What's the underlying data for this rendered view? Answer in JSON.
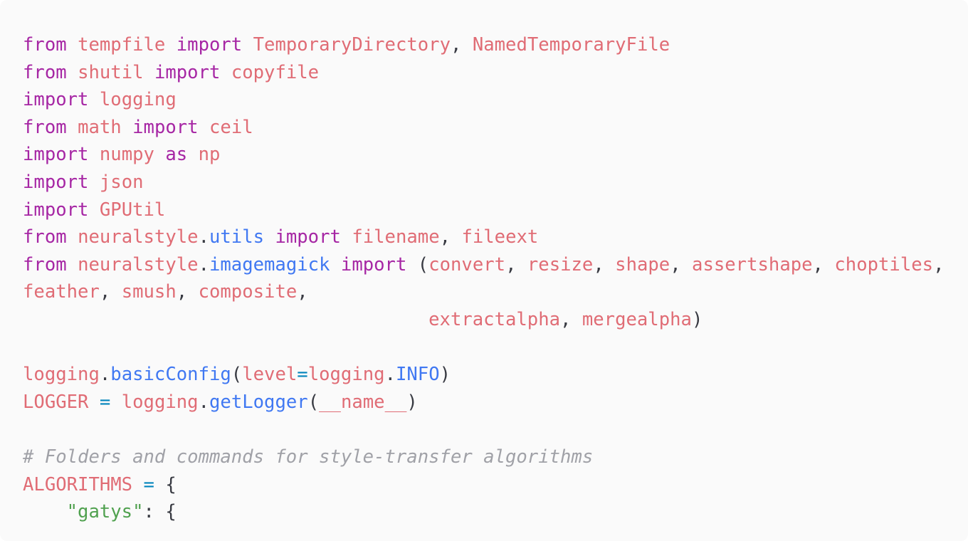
{
  "code": {
    "lines": [
      [
        [
          "kw",
          "from"
        ],
        [
          "pu",
          " "
        ],
        [
          "mod",
          "tempfile"
        ],
        [
          "pu",
          " "
        ],
        [
          "kw",
          "import"
        ],
        [
          "pu",
          " "
        ],
        [
          "id",
          "TemporaryDirectory"
        ],
        [
          "pu",
          ", "
        ],
        [
          "id",
          "NamedTemporaryFile"
        ]
      ],
      [
        [
          "kw",
          "from"
        ],
        [
          "pu",
          " "
        ],
        [
          "mod",
          "shutil"
        ],
        [
          "pu",
          " "
        ],
        [
          "kw",
          "import"
        ],
        [
          "pu",
          " "
        ],
        [
          "id",
          "copyfile"
        ]
      ],
      [
        [
          "kw",
          "import"
        ],
        [
          "pu",
          " "
        ],
        [
          "mod",
          "logging"
        ]
      ],
      [
        [
          "kw",
          "from"
        ],
        [
          "pu",
          " "
        ],
        [
          "mod",
          "math"
        ],
        [
          "pu",
          " "
        ],
        [
          "kw",
          "import"
        ],
        [
          "pu",
          " "
        ],
        [
          "id",
          "ceil"
        ]
      ],
      [
        [
          "kw",
          "import"
        ],
        [
          "pu",
          " "
        ],
        [
          "mod",
          "numpy"
        ],
        [
          "pu",
          " "
        ],
        [
          "kw",
          "as"
        ],
        [
          "pu",
          " "
        ],
        [
          "id",
          "np"
        ]
      ],
      [
        [
          "kw",
          "import"
        ],
        [
          "pu",
          " "
        ],
        [
          "mod",
          "json"
        ]
      ],
      [
        [
          "kw",
          "import"
        ],
        [
          "pu",
          " "
        ],
        [
          "mod",
          "GPUtil"
        ]
      ],
      [
        [
          "kw",
          "from"
        ],
        [
          "pu",
          " "
        ],
        [
          "mod",
          "neuralstyle"
        ],
        [
          "pu",
          "."
        ],
        [
          "fn",
          "utils"
        ],
        [
          "pu",
          " "
        ],
        [
          "kw",
          "import"
        ],
        [
          "pu",
          " "
        ],
        [
          "id",
          "filename"
        ],
        [
          "pu",
          ", "
        ],
        [
          "id",
          "fileext"
        ]
      ],
      [
        [
          "kw",
          "from"
        ],
        [
          "pu",
          " "
        ],
        [
          "mod",
          "neuralstyle"
        ],
        [
          "pu",
          "."
        ],
        [
          "fn",
          "imagemagick"
        ],
        [
          "pu",
          " "
        ],
        [
          "kw",
          "import"
        ],
        [
          "pu",
          " ("
        ],
        [
          "id",
          "convert"
        ],
        [
          "pu",
          ", "
        ],
        [
          "id",
          "resize"
        ],
        [
          "pu",
          ", "
        ],
        [
          "id",
          "shape"
        ],
        [
          "pu",
          ", "
        ],
        [
          "id",
          "assertshape"
        ],
        [
          "pu",
          ", "
        ],
        [
          "id",
          "choptiles"
        ],
        [
          "pu",
          ","
        ]
      ],
      [
        [
          "id",
          "feather"
        ],
        [
          "pu",
          ", "
        ],
        [
          "id",
          "smush"
        ],
        [
          "pu",
          ", "
        ],
        [
          "id",
          "composite"
        ],
        [
          "pu",
          ","
        ]
      ],
      [
        [
          "pu",
          "                                     "
        ],
        [
          "id",
          "extractalpha"
        ],
        [
          "pu",
          ", "
        ],
        [
          "id",
          "mergealpha"
        ],
        [
          "pu",
          ")"
        ]
      ],
      [],
      [
        [
          "mod",
          "logging"
        ],
        [
          "pu",
          "."
        ],
        [
          "fn",
          "basicConfig"
        ],
        [
          "pu",
          "("
        ],
        [
          "id",
          "level"
        ],
        [
          "op",
          "="
        ],
        [
          "mod",
          "logging"
        ],
        [
          "pu",
          "."
        ],
        [
          "fn",
          "INFO"
        ],
        [
          "pu",
          ")"
        ]
      ],
      [
        [
          "id",
          "LOGGER"
        ],
        [
          "pu",
          " "
        ],
        [
          "op",
          "="
        ],
        [
          "pu",
          " "
        ],
        [
          "mod",
          "logging"
        ],
        [
          "pu",
          "."
        ],
        [
          "fn",
          "getLogger"
        ],
        [
          "pu",
          "("
        ],
        [
          "id",
          "__name__"
        ],
        [
          "pu",
          ")"
        ]
      ],
      [],
      [
        [
          "cm",
          "# Folders and commands for style-transfer algorithms"
        ]
      ],
      [
        [
          "id",
          "ALGORITHMS"
        ],
        [
          "pu",
          " "
        ],
        [
          "op",
          "="
        ],
        [
          "pu",
          " {"
        ]
      ],
      [
        [
          "pu",
          "    "
        ],
        [
          "str",
          "\"gatys\""
        ],
        [
          "pu",
          ": {"
        ]
      ]
    ]
  }
}
